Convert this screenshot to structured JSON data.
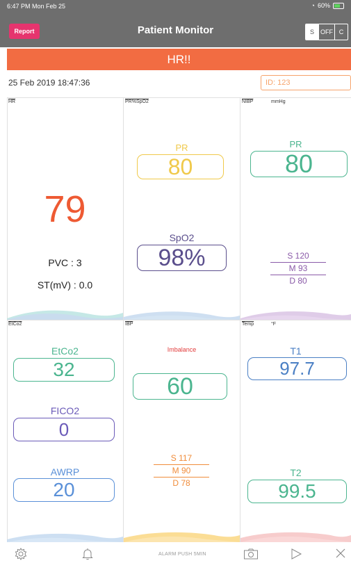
{
  "status_bar": {
    "time_date": "6:47 PM  Mon Feb 25",
    "battery": "60%"
  },
  "nav": {
    "report_label": "Report",
    "title": "Patient Monitor",
    "segments": [
      "S",
      "OFF",
      "C"
    ]
  },
  "alarm_banner": "HR!!",
  "datetime": "25 Feb 2019 18:47:36",
  "patient_id": "ID: 123",
  "panels": {
    "hr": {
      "label": "HR",
      "value": "79",
      "pvc": "PVC : 3",
      "st": "ST(mV) : 0.0"
    },
    "pr_spo2": {
      "label": "PR%SpO2",
      "pr_title": "PR",
      "pr_value": "80",
      "spo2_title": "SpO2",
      "spo2_value": "98%"
    },
    "nibp": {
      "label": "NIBP",
      "unit": "mmHg",
      "pr_title": "PR",
      "pr_value": "80",
      "s": "S 120",
      "m": "M 93",
      "d": "D 80"
    },
    "etco2": {
      "label": "EtCo2",
      "etco2_title": "EtCo2",
      "etco2_value": "32",
      "fico2_title": "FICO2",
      "fico2_value": "0",
      "awrp_title": "AWRP",
      "awrp_value": "20"
    },
    "ibp": {
      "label": "IBP",
      "imbalance": "Imbalance",
      "value": "60",
      "s": "S 117",
      "m": "M 90",
      "d": "D 78"
    },
    "temp": {
      "label": "Temp",
      "unit": "°F",
      "t1_title": "T1",
      "t1_value": "97.7",
      "t2_title": "T2",
      "t2_value": "99.5"
    }
  },
  "bottom_bar": {
    "alarm_push": "ALARM PUSH 5MIN",
    "icons": [
      "gear-icon",
      "bell-icon",
      "camera-icon",
      "play-icon",
      "close-icon"
    ]
  },
  "colors": {
    "nav_bg": "#6e6e6e",
    "report": "#e6346e",
    "alarm": "#f26c42",
    "hr_value": "#ee5a33",
    "pr": "#f0c94a",
    "spo2_box": "#5a4e8c",
    "nibp_green": "#4bb58f",
    "nibp_purple": "#8a5aa8",
    "fico2": "#6a5ab8",
    "awrp": "#5a90d8",
    "ibp_orange": "#f08c3a",
    "temp_blue": "#4a7fc4",
    "temp_green": "#4bb58f"
  }
}
